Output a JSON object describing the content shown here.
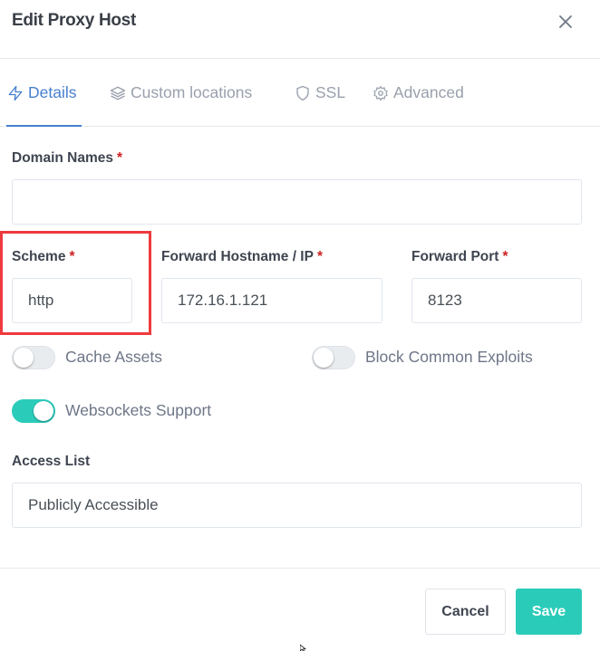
{
  "dialog": {
    "title": "Edit Proxy Host",
    "close_icon": "close-icon"
  },
  "tabs": [
    {
      "label": "Details",
      "icon": "lightning-icon",
      "active": true
    },
    {
      "label": "Custom locations",
      "icon": "layers-icon",
      "active": false
    },
    {
      "label": "SSL",
      "icon": "shield-icon",
      "active": false
    },
    {
      "label": "Advanced",
      "icon": "gear-icon",
      "active": false
    }
  ],
  "form": {
    "domain_names": {
      "label": "Domain Names",
      "required_mark": "*",
      "value": ""
    },
    "scheme": {
      "label": "Scheme",
      "required_mark": "*",
      "value": "http"
    },
    "forward_hostname": {
      "label": "Forward Hostname / IP",
      "required_mark": "*",
      "value": "172.16.1.121"
    },
    "forward_port": {
      "label": "Forward Port",
      "required_mark": "*",
      "value": "8123"
    },
    "toggles": {
      "cache_assets": {
        "label": "Cache Assets",
        "on": false
      },
      "block_exploits": {
        "label": "Block Common Exploits",
        "on": false
      },
      "websockets": {
        "label": "Websockets Support",
        "on": true
      }
    },
    "access_list": {
      "label": "Access List",
      "value": "Publicly Accessible"
    }
  },
  "footer": {
    "cancel_label": "Cancel",
    "save_label": "Save"
  },
  "colors": {
    "accent_blue": "#467fcf",
    "teal": "#2bcbba",
    "highlight_red": "#ef3a3e",
    "required_red": "#cd201f"
  }
}
